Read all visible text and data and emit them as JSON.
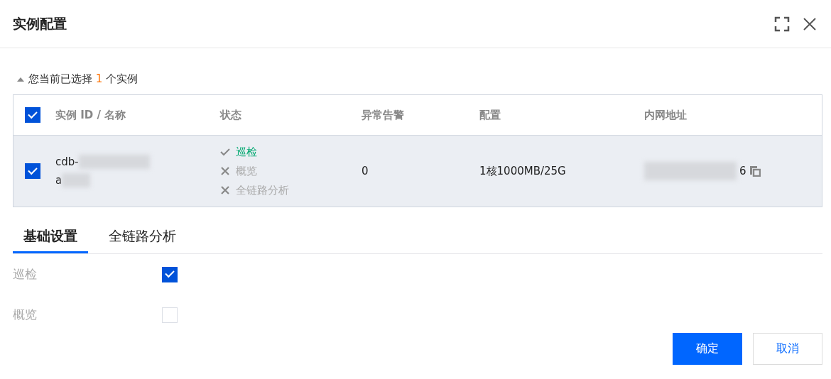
{
  "dialog": {
    "title": "实例配置"
  },
  "summary": {
    "expanded": true,
    "prefix": "您当前已选择",
    "count": "1",
    "suffix": "个实例"
  },
  "table": {
    "all_checked": true,
    "columns": [
      "实例 ID / 名称",
      "状态",
      "异常告警",
      "配置",
      "内网地址"
    ],
    "rows": [
      {
        "checked": true,
        "id_line_1": "cdb-",
        "id_line_2": "a",
        "status": [
          {
            "label": "巡检",
            "passed": true
          },
          {
            "label": "概览",
            "passed": false
          },
          {
            "label": "全链路分析",
            "passed": false
          }
        ],
        "alarms": "0",
        "config": "1核1000MB/25G",
        "address_tail": "6"
      }
    ]
  },
  "tabs": [
    {
      "label": "基础设置",
      "selected": true
    },
    {
      "label": "全链路分析",
      "selected": false
    }
  ],
  "settings": [
    {
      "label": "巡检",
      "checked": true
    },
    {
      "label": "概览",
      "checked": false
    }
  ],
  "buttons": [
    {
      "label": "确定",
      "kind": "primary"
    },
    {
      "label": "取消",
      "kind": "secondary"
    }
  ]
}
